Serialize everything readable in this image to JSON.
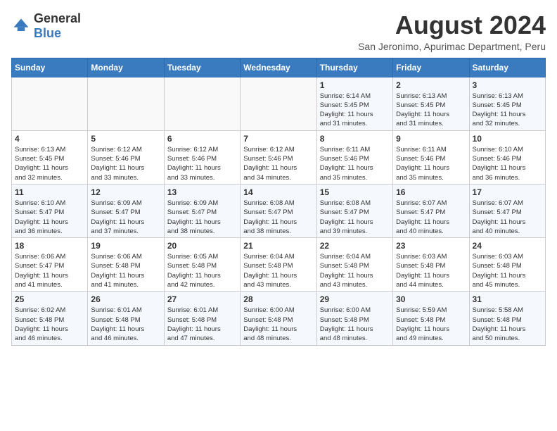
{
  "logo": {
    "general": "General",
    "blue": "Blue"
  },
  "header": {
    "title": "August 2024",
    "subtitle": "San Jeronimo, Apurimac Department, Peru"
  },
  "weekdays": [
    "Sunday",
    "Monday",
    "Tuesday",
    "Wednesday",
    "Thursday",
    "Friday",
    "Saturday"
  ],
  "weeks": [
    [
      {
        "day": "",
        "info": ""
      },
      {
        "day": "",
        "info": ""
      },
      {
        "day": "",
        "info": ""
      },
      {
        "day": "",
        "info": ""
      },
      {
        "day": "1",
        "info": "Sunrise: 6:14 AM\nSunset: 5:45 PM\nDaylight: 11 hours\nand 31 minutes."
      },
      {
        "day": "2",
        "info": "Sunrise: 6:13 AM\nSunset: 5:45 PM\nDaylight: 11 hours\nand 31 minutes."
      },
      {
        "day": "3",
        "info": "Sunrise: 6:13 AM\nSunset: 5:45 PM\nDaylight: 11 hours\nand 32 minutes."
      }
    ],
    [
      {
        "day": "4",
        "info": "Sunrise: 6:13 AM\nSunset: 5:45 PM\nDaylight: 11 hours\nand 32 minutes."
      },
      {
        "day": "5",
        "info": "Sunrise: 6:12 AM\nSunset: 5:46 PM\nDaylight: 11 hours\nand 33 minutes."
      },
      {
        "day": "6",
        "info": "Sunrise: 6:12 AM\nSunset: 5:46 PM\nDaylight: 11 hours\nand 33 minutes."
      },
      {
        "day": "7",
        "info": "Sunrise: 6:12 AM\nSunset: 5:46 PM\nDaylight: 11 hours\nand 34 minutes."
      },
      {
        "day": "8",
        "info": "Sunrise: 6:11 AM\nSunset: 5:46 PM\nDaylight: 11 hours\nand 35 minutes."
      },
      {
        "day": "9",
        "info": "Sunrise: 6:11 AM\nSunset: 5:46 PM\nDaylight: 11 hours\nand 35 minutes."
      },
      {
        "day": "10",
        "info": "Sunrise: 6:10 AM\nSunset: 5:46 PM\nDaylight: 11 hours\nand 36 minutes."
      }
    ],
    [
      {
        "day": "11",
        "info": "Sunrise: 6:10 AM\nSunset: 5:47 PM\nDaylight: 11 hours\nand 36 minutes."
      },
      {
        "day": "12",
        "info": "Sunrise: 6:09 AM\nSunset: 5:47 PM\nDaylight: 11 hours\nand 37 minutes."
      },
      {
        "day": "13",
        "info": "Sunrise: 6:09 AM\nSunset: 5:47 PM\nDaylight: 11 hours\nand 38 minutes."
      },
      {
        "day": "14",
        "info": "Sunrise: 6:08 AM\nSunset: 5:47 PM\nDaylight: 11 hours\nand 38 minutes."
      },
      {
        "day": "15",
        "info": "Sunrise: 6:08 AM\nSunset: 5:47 PM\nDaylight: 11 hours\nand 39 minutes."
      },
      {
        "day": "16",
        "info": "Sunrise: 6:07 AM\nSunset: 5:47 PM\nDaylight: 11 hours\nand 40 minutes."
      },
      {
        "day": "17",
        "info": "Sunrise: 6:07 AM\nSunset: 5:47 PM\nDaylight: 11 hours\nand 40 minutes."
      }
    ],
    [
      {
        "day": "18",
        "info": "Sunrise: 6:06 AM\nSunset: 5:47 PM\nDaylight: 11 hours\nand 41 minutes."
      },
      {
        "day": "19",
        "info": "Sunrise: 6:06 AM\nSunset: 5:48 PM\nDaylight: 11 hours\nand 41 minutes."
      },
      {
        "day": "20",
        "info": "Sunrise: 6:05 AM\nSunset: 5:48 PM\nDaylight: 11 hours\nand 42 minutes."
      },
      {
        "day": "21",
        "info": "Sunrise: 6:04 AM\nSunset: 5:48 PM\nDaylight: 11 hours\nand 43 minutes."
      },
      {
        "day": "22",
        "info": "Sunrise: 6:04 AM\nSunset: 5:48 PM\nDaylight: 11 hours\nand 43 minutes."
      },
      {
        "day": "23",
        "info": "Sunrise: 6:03 AM\nSunset: 5:48 PM\nDaylight: 11 hours\nand 44 minutes."
      },
      {
        "day": "24",
        "info": "Sunrise: 6:03 AM\nSunset: 5:48 PM\nDaylight: 11 hours\nand 45 minutes."
      }
    ],
    [
      {
        "day": "25",
        "info": "Sunrise: 6:02 AM\nSunset: 5:48 PM\nDaylight: 11 hours\nand 46 minutes."
      },
      {
        "day": "26",
        "info": "Sunrise: 6:01 AM\nSunset: 5:48 PM\nDaylight: 11 hours\nand 46 minutes."
      },
      {
        "day": "27",
        "info": "Sunrise: 6:01 AM\nSunset: 5:48 PM\nDaylight: 11 hours\nand 47 minutes."
      },
      {
        "day": "28",
        "info": "Sunrise: 6:00 AM\nSunset: 5:48 PM\nDaylight: 11 hours\nand 48 minutes."
      },
      {
        "day": "29",
        "info": "Sunrise: 6:00 AM\nSunset: 5:48 PM\nDaylight: 11 hours\nand 48 minutes."
      },
      {
        "day": "30",
        "info": "Sunrise: 5:59 AM\nSunset: 5:48 PM\nDaylight: 11 hours\nand 49 minutes."
      },
      {
        "day": "31",
        "info": "Sunrise: 5:58 AM\nSunset: 5:48 PM\nDaylight: 11 hours\nand 50 minutes."
      }
    ]
  ]
}
